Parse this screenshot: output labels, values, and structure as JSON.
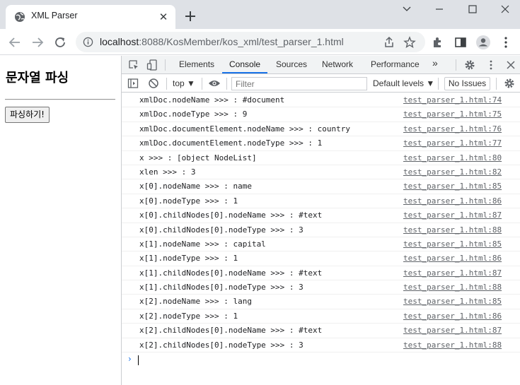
{
  "browser": {
    "tab_title": "XML Parser",
    "tab_close": "✕",
    "url_host": "localhost",
    "url_path": ":8088/KosMember/kos_xml/test_parser_1.html"
  },
  "page": {
    "heading": "문자열 파싱",
    "button_label": "파싱하기!"
  },
  "devtools": {
    "tabs": [
      "Elements",
      "Console",
      "Sources",
      "Network",
      "Performance"
    ],
    "more_tabs": "»",
    "context": "top ▼",
    "filter_placeholder": "Filter",
    "levels": "Default levels ▼",
    "issues": "No Issues",
    "prompt_symbol": "›",
    "logs": [
      {
        "msg": "xmlDoc.nodeName >>> : #document",
        "src": "test_parser_1.html:74"
      },
      {
        "msg": "xmlDoc.nodeType >>> : 9",
        "src": "test_parser_1.html:75"
      },
      {
        "msg": "xmlDoc.documentElement.nodeName >>> : country",
        "src": "test_parser_1.html:76"
      },
      {
        "msg": "xmlDoc.documentElement.nodeType >>> : 1",
        "src": "test_parser_1.html:77"
      },
      {
        "msg": "x >>> : [object NodeList]",
        "src": "test_parser_1.html:80"
      },
      {
        "msg": "xlen >>> : 3",
        "src": "test_parser_1.html:82"
      },
      {
        "msg": "x[0].nodeName >>> : name",
        "src": "test_parser_1.html:85"
      },
      {
        "msg": "x[0].nodeType >>> : 1",
        "src": "test_parser_1.html:86"
      },
      {
        "msg": "x[0].childNodes[0].nodeName >>> : #text",
        "src": "test_parser_1.html:87"
      },
      {
        "msg": "x[0].childNodes[0].nodeType >>> : 3",
        "src": "test_parser_1.html:88"
      },
      {
        "msg": "x[1].nodeName >>> : capital",
        "src": "test_parser_1.html:85"
      },
      {
        "msg": "x[1].nodeType >>> : 1",
        "src": "test_parser_1.html:86"
      },
      {
        "msg": "x[1].childNodes[0].nodeName >>> : #text",
        "src": "test_parser_1.html:87"
      },
      {
        "msg": "x[1].childNodes[0].nodeType >>> : 3",
        "src": "test_parser_1.html:88"
      },
      {
        "msg": "x[2].nodeName >>> : lang",
        "src": "test_parser_1.html:85"
      },
      {
        "msg": "x[2].nodeType >>> : 1",
        "src": "test_parser_1.html:86"
      },
      {
        "msg": "x[2].childNodes[0].nodeName >>> : #text",
        "src": "test_parser_1.html:87"
      },
      {
        "msg": "x[2].childNodes[0].nodeType >>> : 3",
        "src": "test_parser_1.html:88"
      }
    ]
  },
  "colors": {
    "titlebar": "#dee1e6",
    "accent": "#1a73e8"
  }
}
